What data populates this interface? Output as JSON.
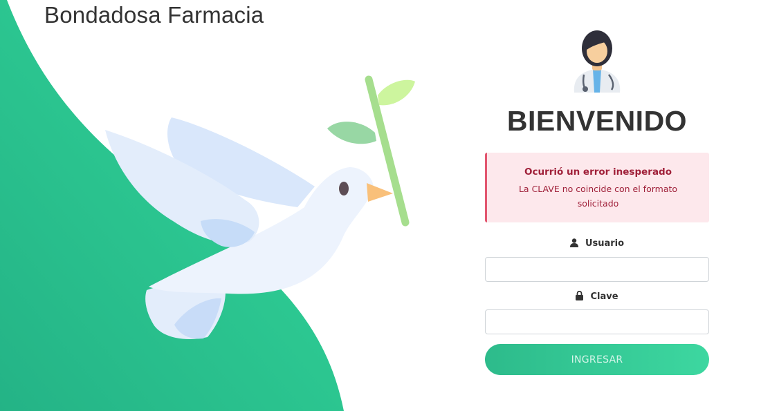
{
  "brand": {
    "name": "Bondadosa Farmacia"
  },
  "login": {
    "welcome": "BIENVENIDO",
    "error": {
      "title": "Ocurrió un error inesperado",
      "message": "La CLAVE no coincide con el formato solicitado"
    },
    "user_label": "Usuario",
    "user_value": "",
    "password_label": "Clave",
    "password_value": "",
    "submit_label": "INGRESAR"
  },
  "icons": {
    "user": "user-icon",
    "lock": "lock-icon",
    "avatar": "doctor-avatar-icon",
    "illustration": "dove-with-olive-branch-icon"
  },
  "colors": {
    "accent": "#2dc794",
    "error_text": "#a0213a",
    "error_bg": "#fde8ec",
    "error_border": "#e2566f"
  }
}
